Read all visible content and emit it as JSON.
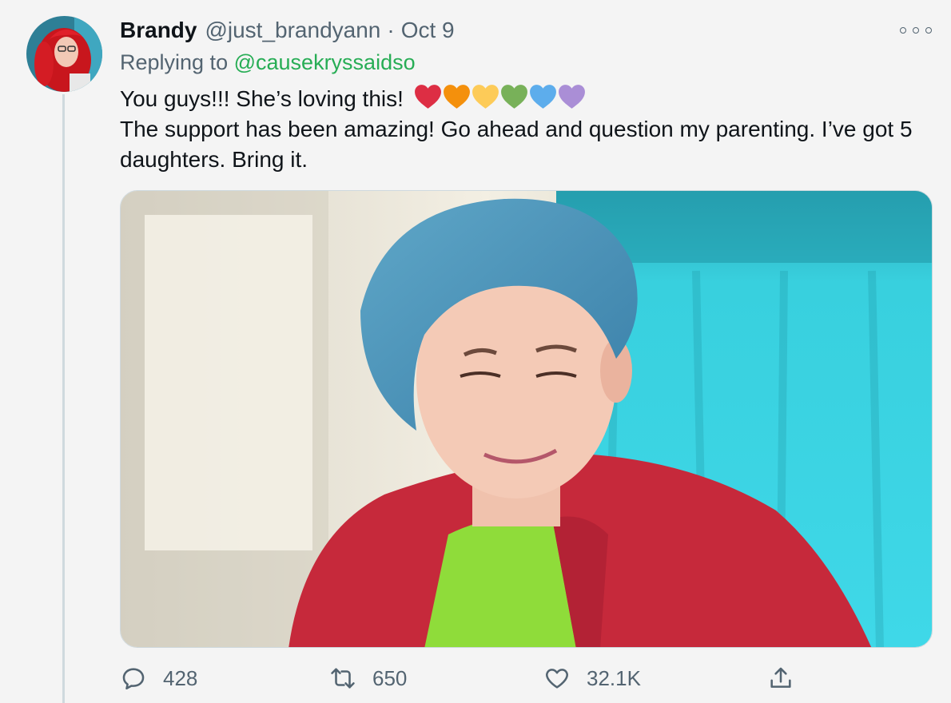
{
  "tweet": {
    "author_name": "Brandy",
    "author_handle": "@just_brandyann",
    "separator": "·",
    "date": "Oct 9",
    "replying_prefix": "Replying to",
    "replying_handle": "@causekryssaidso",
    "text_line1": "You guys!!! She’s loving this!",
    "text_rest": "The support has been amazing! Go ahead and question my parenting. I’ve got 5 daughters. Bring it.",
    "hearts": [
      {
        "name": "red-heart-icon",
        "color": "#dd2e44"
      },
      {
        "name": "orange-heart-icon",
        "color": "#f4900c"
      },
      {
        "name": "yellow-heart-icon",
        "color": "#fdcb58"
      },
      {
        "name": "green-heart-icon",
        "color": "#78b159"
      },
      {
        "name": "blue-heart-icon",
        "color": "#5dadec"
      },
      {
        "name": "purple-heart-icon",
        "color": "#aa8ed6"
      }
    ],
    "stats": {
      "replies": "428",
      "retweets": "650",
      "likes": "32.1K"
    }
  },
  "colors": {
    "mention": "#27ad55",
    "secondary_text": "#536471",
    "background": "#f4f4f4"
  }
}
